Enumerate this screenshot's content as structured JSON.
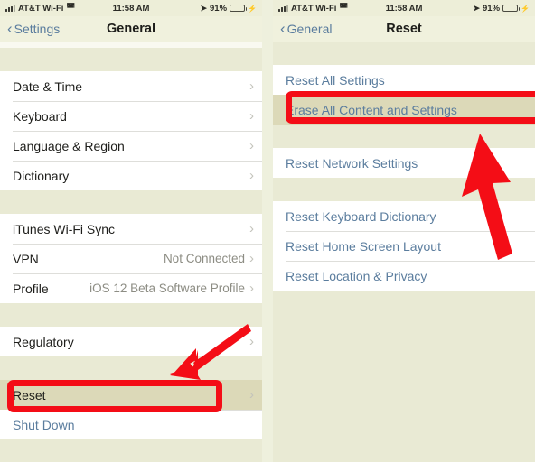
{
  "status_bar": {
    "carrier": "AT&T Wi-Fi",
    "time": "11:58 AM",
    "battery_percent": "91%",
    "signal_icon": "signal-bars-icon",
    "wifi_icon": "wifi-icon",
    "location_icon": "location-arrow-icon",
    "battery_icon": "battery-icon",
    "charging_icon": "charging-bolt-icon"
  },
  "colors": {
    "accent_blue": "#5b7d9e",
    "annotation_red": "#f40d16",
    "battery_green": "#3fce45",
    "row_background": "#ffffff",
    "page_background": "#e9ead4",
    "pressed_row": "#dcd9b8"
  },
  "left_screen": {
    "nav": {
      "back_label": "Settings",
      "title": "General"
    },
    "groups": [
      {
        "rows": [
          {
            "label": "Date & Time",
            "value": "",
            "chevron": true
          },
          {
            "label": "Keyboard",
            "value": "",
            "chevron": true
          },
          {
            "label": "Language & Region",
            "value": "",
            "chevron": true
          },
          {
            "label": "Dictionary",
            "value": "",
            "chevron": true
          }
        ]
      },
      {
        "rows": [
          {
            "label": "iTunes Wi-Fi Sync",
            "value": "",
            "chevron": true
          },
          {
            "label": "VPN",
            "value": "Not Connected",
            "chevron": true
          },
          {
            "label": "Profile",
            "value": "iOS 12 Beta Software Profile",
            "chevron": true
          }
        ]
      },
      {
        "rows": [
          {
            "label": "Regulatory",
            "value": "",
            "chevron": true
          }
        ]
      },
      {
        "rows": [
          {
            "label": "Reset",
            "value": "",
            "chevron": true,
            "pressed": true
          },
          {
            "label": "Shut Down",
            "value": "",
            "chevron": false,
            "link": true
          }
        ]
      }
    ]
  },
  "right_screen": {
    "nav": {
      "back_label": "General",
      "title": "Reset"
    },
    "groups": [
      {
        "rows": [
          {
            "label": "Reset All Settings",
            "link": true
          },
          {
            "label": "Erase All Content and Settings",
            "link": true,
            "pressed": true
          }
        ]
      },
      {
        "rows": [
          {
            "label": "Reset Network Settings",
            "link": true
          }
        ]
      },
      {
        "rows": [
          {
            "label": "Reset Keyboard Dictionary",
            "link": true
          },
          {
            "label": "Reset Home Screen Layout",
            "link": true
          },
          {
            "label": "Reset Location & Privacy",
            "link": true
          }
        ]
      }
    ]
  },
  "annotations": {
    "left_highlight_target": "Reset",
    "left_arrow": "red-arrow-down-left",
    "right_highlight_target": "Erase All Content and Settings",
    "right_arrow": "red-arrow-up"
  }
}
